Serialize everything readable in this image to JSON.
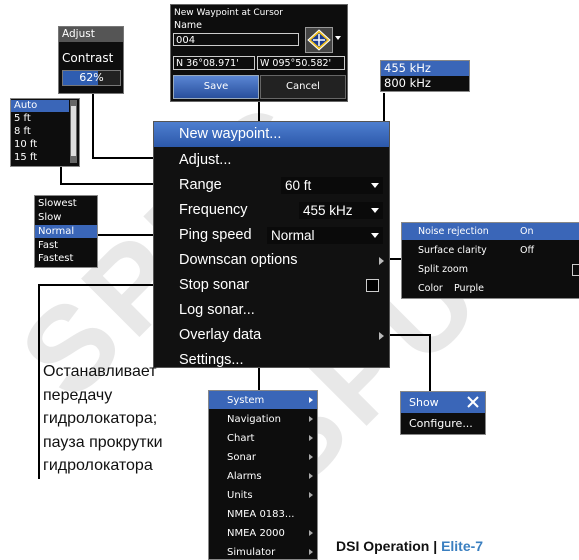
{
  "new_waypoint_dialog": {
    "title": "New Waypoint at Cursor",
    "name_label": "Name",
    "name_value": "004",
    "lat": "N  36°08.971'",
    "lon": "W  095°50.582'",
    "save_label": "Save",
    "cancel_label": "Cancel"
  },
  "adjust_popup": {
    "title": "Adjust",
    "label": "Contrast",
    "value": "62%"
  },
  "range_list": [
    "Auto",
    "5 ft",
    "8 ft",
    "10 ft",
    "15 ft"
  ],
  "frequency_list": [
    "455 kHz",
    "800 kHz"
  ],
  "ping_list": [
    "Slowest",
    "Slow",
    "Normal",
    "Fast",
    "Fastest"
  ],
  "main_menu": {
    "new_waypoint": "New waypoint...",
    "adjust": "Adjust...",
    "range_label": "Range",
    "range_value": "60 ft",
    "frequency_label": "Frequency",
    "frequency_value": "455 kHz",
    "ping_label": "Ping speed",
    "ping_value": "Normal",
    "downscan": "Downscan options",
    "stop_sonar": "Stop sonar",
    "log_sonar": "Log sonar...",
    "overlay": "Overlay data",
    "settings": "Settings..."
  },
  "downscan_options": {
    "noise_label": "Noise rejection",
    "noise_value": "On",
    "clarity_label": "Surface clarity",
    "clarity_value": "Off",
    "split_zoom": "Split zoom",
    "color_label": "Color",
    "color_value": "Purple"
  },
  "overlay_popup": {
    "show": "Show",
    "configure": "Configure..."
  },
  "settings_list": [
    "System",
    "Navigation",
    "Chart",
    "Sonar",
    "Alarms",
    "Units",
    "NMEA 0183...",
    "NMEA 2000",
    "Simulator"
  ],
  "callout": [
    "Останавливает",
    "передачу",
    "гидролокатора;",
    "пауза прокрутки",
    "гидролокатора"
  ],
  "footer": {
    "section": "DSI Operation",
    "separator": "|",
    "product": "Elite-7"
  },
  "watermark": "SPEC SPU"
}
